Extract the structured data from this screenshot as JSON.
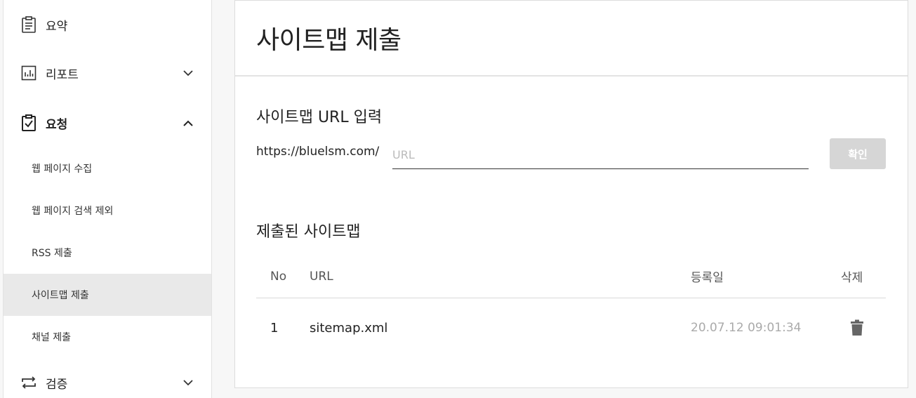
{
  "sidebar": {
    "items": [
      {
        "label": "요약",
        "icon": "clipboard-list-icon"
      },
      {
        "label": "리포트",
        "icon": "bar-chart-icon",
        "expanded": false
      },
      {
        "label": "요청",
        "icon": "clipboard-check-icon",
        "expanded": true
      },
      {
        "label": "검증",
        "icon": "repeat-icon",
        "expanded": false
      }
    ],
    "sub_items": [
      {
        "label": "웹 페이지 수집"
      },
      {
        "label": "웹 페이지 검색 제외"
      },
      {
        "label": "RSS 제출"
      },
      {
        "label": "사이트맵 제출",
        "active": true
      },
      {
        "label": "채널 제출"
      }
    ]
  },
  "main": {
    "title": "사이트맵 제출",
    "input_section": {
      "title": "사이트맵 URL 입력",
      "url_prefix": "https://bluelsm.com/",
      "placeholder": "URL",
      "value": "",
      "confirm_label": "확인"
    },
    "submitted_section": {
      "title": "제출된 사이트맵",
      "columns": [
        "No",
        "URL",
        "등록일",
        "삭제"
      ],
      "rows": [
        {
          "no": "1",
          "url": "sitemap.xml",
          "date": "20.07.12 09:01:34",
          "delete_icon": "trash-icon"
        }
      ]
    }
  },
  "colors": {
    "active_sub_bg": "#e9e9e9",
    "button_disabled": "#d6d6d6",
    "date_text": "#aaaaaa"
  }
}
